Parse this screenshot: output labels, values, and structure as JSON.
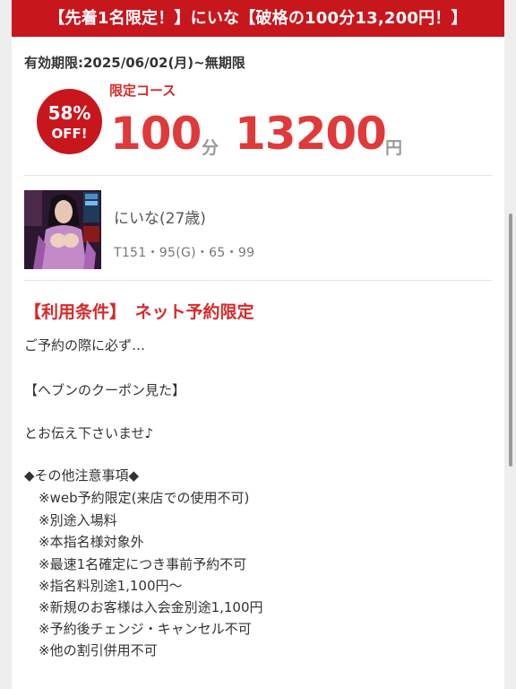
{
  "banner": {
    "text": "【先着1名限定！】にいな【破格の100分13,200円！】"
  },
  "expiry": {
    "text": "有効期限:2025/06/02(月)~無期限"
  },
  "badge": {
    "percent": "58%",
    "off": "OFF!"
  },
  "course": {
    "label": "限定コース",
    "minutes": "100",
    "minutes_unit": "分",
    "price": "13200",
    "price_unit": "円"
  },
  "girl": {
    "name": "にいな(27歳)",
    "stats": "T151・95(G)・65・99"
  },
  "conditions": {
    "heading": "【利用条件】　ネット予約限定",
    "lines": [
      "ご予約の際に必ず…",
      "【ヘブンのクーポン見た】",
      "とお伝え下さいませ♪",
      "◆その他注意事項◆"
    ],
    "notes": [
      "※web予約限定(来店での使用不可)",
      "※別途入場料",
      "※本指名様対象外",
      "※最速1名確定につき事前予約不可",
      "※指名料別途1,100円～",
      "※新規のお客様は入会金別途1,100円",
      "※予約後チェンジ・キャンセル不可",
      "※他の割引併用不可"
    ]
  },
  "colors": {
    "accent": "#c8161d",
    "price": "#e0393a",
    "background": "#eeeeee"
  }
}
